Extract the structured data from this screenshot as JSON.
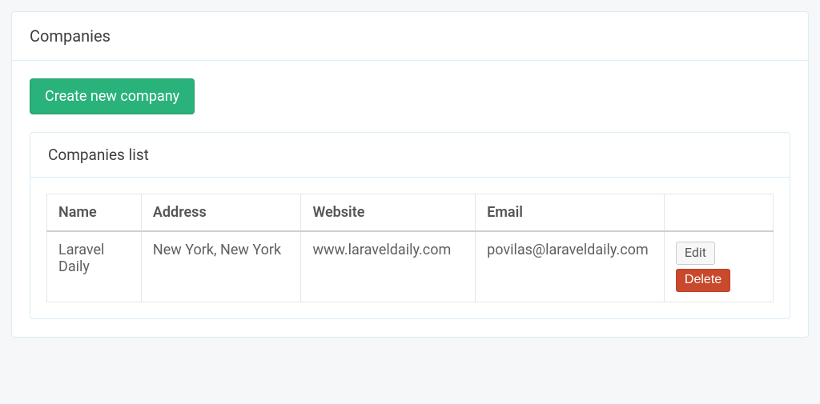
{
  "page": {
    "title": "Companies",
    "createButton": "Create new company",
    "listTitle": "Companies list"
  },
  "table": {
    "headers": {
      "name": "Name",
      "address": "Address",
      "website": "Website",
      "email": "Email",
      "actions": ""
    },
    "rows": [
      {
        "name": "Laravel Daily",
        "address": "New York, New York",
        "website": "www.laraveldaily.com",
        "email": "povilas@laraveldaily.com"
      }
    ]
  },
  "actions": {
    "edit": "Edit",
    "delete": "Delete"
  }
}
